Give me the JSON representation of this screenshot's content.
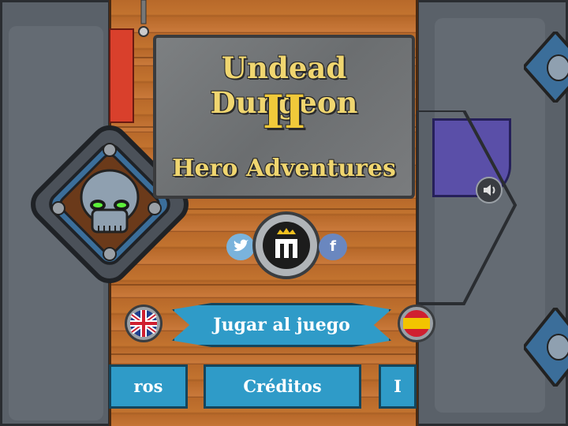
{
  "title": {
    "line1": "Undead Dungeon",
    "line2": "II",
    "line3": "Hero Adventures"
  },
  "buttons": {
    "play": "Jugar al juego",
    "credits": "Créditos",
    "left_partial": "ros",
    "right_partial": "I"
  },
  "social": {
    "twitter_icon": "twitter-icon",
    "facebook_label": "f",
    "logo_label": "m"
  },
  "colors": {
    "title_gold": "#f0c93a",
    "ribbon_blue": "#2f9bc8",
    "wood": "#b8692a",
    "stone": "#5a6169",
    "skull_eye": "#5df03a"
  }
}
